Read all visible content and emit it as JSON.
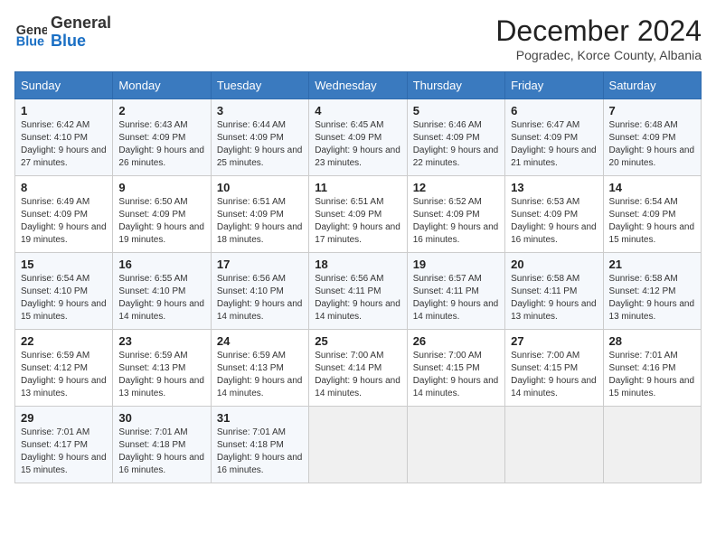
{
  "logo": {
    "general": "General",
    "blue": "Blue"
  },
  "title": "December 2024",
  "location": "Pogradec, Korce County, Albania",
  "days_of_week": [
    "Sunday",
    "Monday",
    "Tuesday",
    "Wednesday",
    "Thursday",
    "Friday",
    "Saturday"
  ],
  "weeks": [
    [
      {
        "day": "1",
        "sunrise": "6:42 AM",
        "sunset": "4:10 PM",
        "daylight": "9 hours and 27 minutes."
      },
      {
        "day": "2",
        "sunrise": "6:43 AM",
        "sunset": "4:09 PM",
        "daylight": "9 hours and 26 minutes."
      },
      {
        "day": "3",
        "sunrise": "6:44 AM",
        "sunset": "4:09 PM",
        "daylight": "9 hours and 25 minutes."
      },
      {
        "day": "4",
        "sunrise": "6:45 AM",
        "sunset": "4:09 PM",
        "daylight": "9 hours and 23 minutes."
      },
      {
        "day": "5",
        "sunrise": "6:46 AM",
        "sunset": "4:09 PM",
        "daylight": "9 hours and 22 minutes."
      },
      {
        "day": "6",
        "sunrise": "6:47 AM",
        "sunset": "4:09 PM",
        "daylight": "9 hours and 21 minutes."
      },
      {
        "day": "7",
        "sunrise": "6:48 AM",
        "sunset": "4:09 PM",
        "daylight": "9 hours and 20 minutes."
      }
    ],
    [
      {
        "day": "8",
        "sunrise": "6:49 AM",
        "sunset": "4:09 PM",
        "daylight": "9 hours and 19 minutes."
      },
      {
        "day": "9",
        "sunrise": "6:50 AM",
        "sunset": "4:09 PM",
        "daylight": "9 hours and 19 minutes."
      },
      {
        "day": "10",
        "sunrise": "6:51 AM",
        "sunset": "4:09 PM",
        "daylight": "9 hours and 18 minutes."
      },
      {
        "day": "11",
        "sunrise": "6:51 AM",
        "sunset": "4:09 PM",
        "daylight": "9 hours and 17 minutes."
      },
      {
        "day": "12",
        "sunrise": "6:52 AM",
        "sunset": "4:09 PM",
        "daylight": "9 hours and 16 minutes."
      },
      {
        "day": "13",
        "sunrise": "6:53 AM",
        "sunset": "4:09 PM",
        "daylight": "9 hours and 16 minutes."
      },
      {
        "day": "14",
        "sunrise": "6:54 AM",
        "sunset": "4:09 PM",
        "daylight": "9 hours and 15 minutes."
      }
    ],
    [
      {
        "day": "15",
        "sunrise": "6:54 AM",
        "sunset": "4:10 PM",
        "daylight": "9 hours and 15 minutes."
      },
      {
        "day": "16",
        "sunrise": "6:55 AM",
        "sunset": "4:10 PM",
        "daylight": "9 hours and 14 minutes."
      },
      {
        "day": "17",
        "sunrise": "6:56 AM",
        "sunset": "4:10 PM",
        "daylight": "9 hours and 14 minutes."
      },
      {
        "day": "18",
        "sunrise": "6:56 AM",
        "sunset": "4:11 PM",
        "daylight": "9 hours and 14 minutes."
      },
      {
        "day": "19",
        "sunrise": "6:57 AM",
        "sunset": "4:11 PM",
        "daylight": "9 hours and 14 minutes."
      },
      {
        "day": "20",
        "sunrise": "6:58 AM",
        "sunset": "4:11 PM",
        "daylight": "9 hours and 13 minutes."
      },
      {
        "day": "21",
        "sunrise": "6:58 AM",
        "sunset": "4:12 PM",
        "daylight": "9 hours and 13 minutes."
      }
    ],
    [
      {
        "day": "22",
        "sunrise": "6:59 AM",
        "sunset": "4:12 PM",
        "daylight": "9 hours and 13 minutes."
      },
      {
        "day": "23",
        "sunrise": "6:59 AM",
        "sunset": "4:13 PM",
        "daylight": "9 hours and 13 minutes."
      },
      {
        "day": "24",
        "sunrise": "6:59 AM",
        "sunset": "4:13 PM",
        "daylight": "9 hours and 14 minutes."
      },
      {
        "day": "25",
        "sunrise": "7:00 AM",
        "sunset": "4:14 PM",
        "daylight": "9 hours and 14 minutes."
      },
      {
        "day": "26",
        "sunrise": "7:00 AM",
        "sunset": "4:15 PM",
        "daylight": "9 hours and 14 minutes."
      },
      {
        "day": "27",
        "sunrise": "7:00 AM",
        "sunset": "4:15 PM",
        "daylight": "9 hours and 14 minutes."
      },
      {
        "day": "28",
        "sunrise": "7:01 AM",
        "sunset": "4:16 PM",
        "daylight": "9 hours and 15 minutes."
      }
    ],
    [
      {
        "day": "29",
        "sunrise": "7:01 AM",
        "sunset": "4:17 PM",
        "daylight": "9 hours and 15 minutes."
      },
      {
        "day": "30",
        "sunrise": "7:01 AM",
        "sunset": "4:18 PM",
        "daylight": "9 hours and 16 minutes."
      },
      {
        "day": "31",
        "sunrise": "7:01 AM",
        "sunset": "4:18 PM",
        "daylight": "9 hours and 16 minutes."
      },
      null,
      null,
      null,
      null
    ]
  ]
}
